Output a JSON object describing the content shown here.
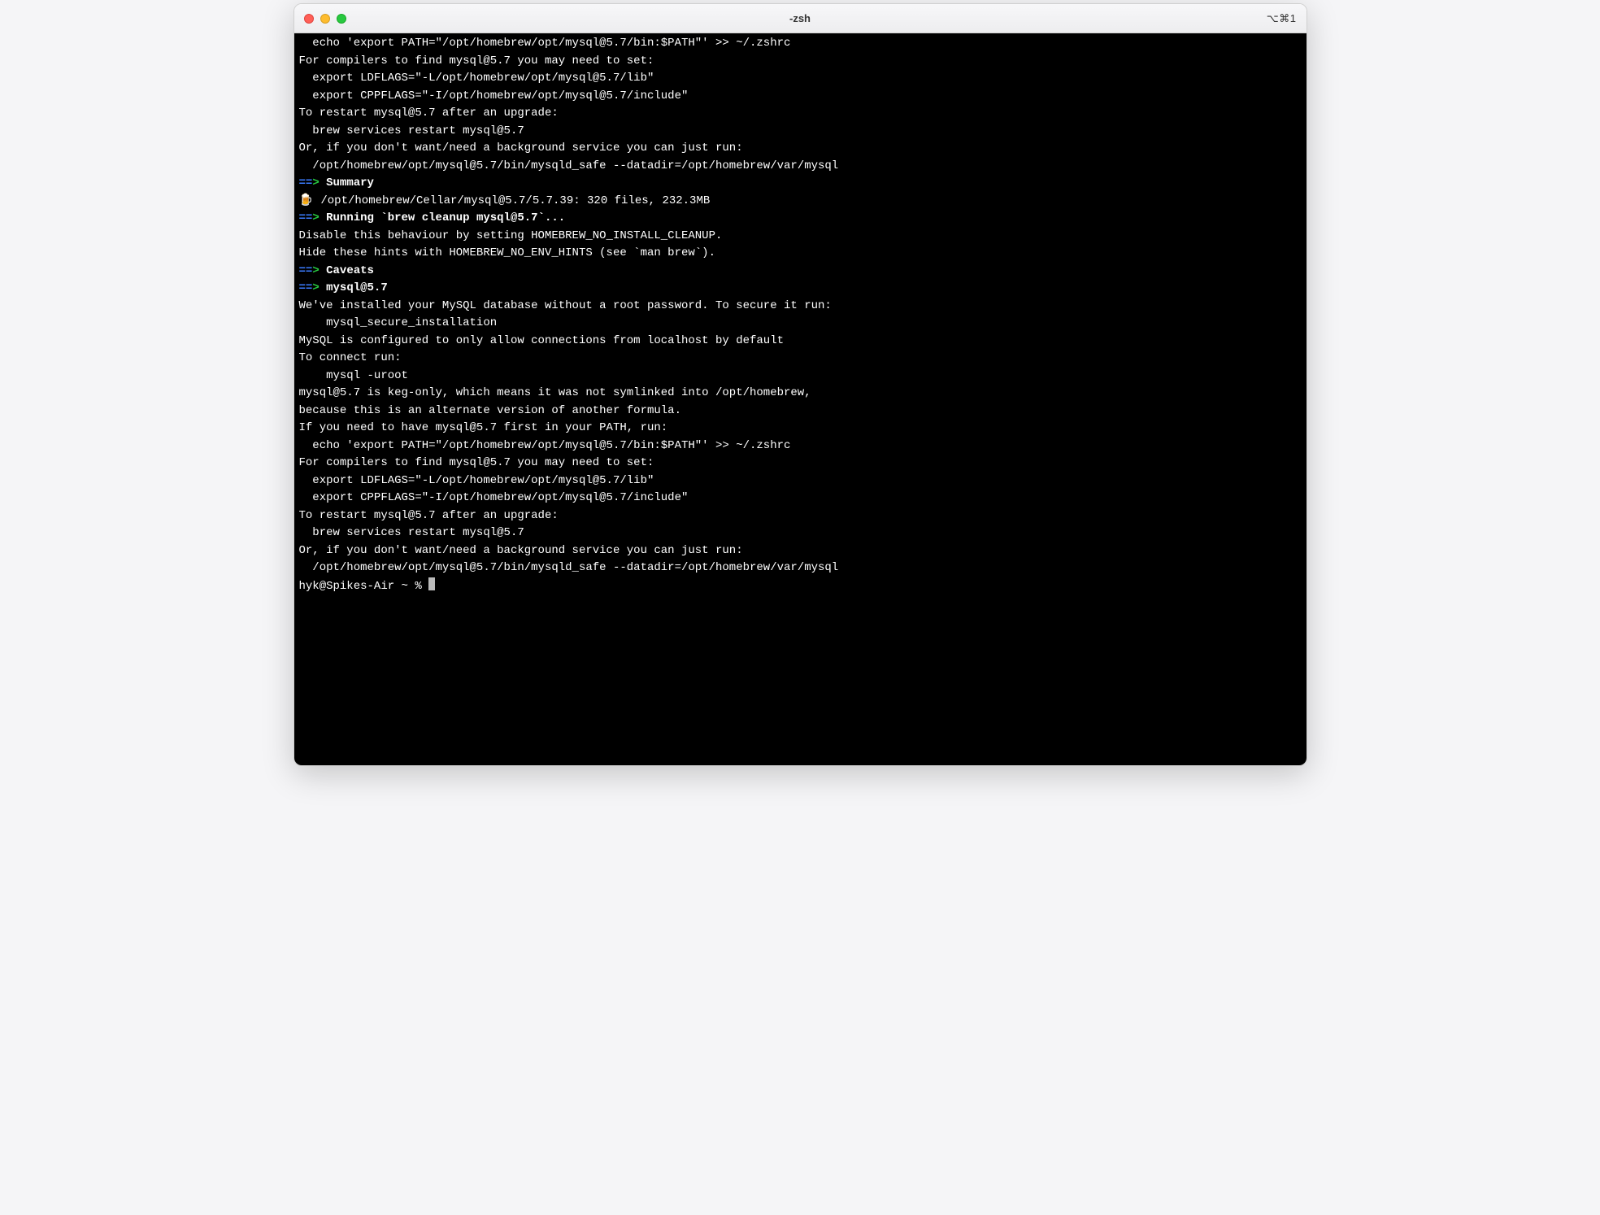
{
  "window": {
    "title": "-zsh",
    "right_shortcut": "⌥⌘1"
  },
  "terminal": {
    "lines": {
      "l01": "  echo 'export PATH=\"/opt/homebrew/opt/mysql@5.7/bin:$PATH\"' >> ~/.zshrc",
      "l02": "",
      "l03": "For compilers to find mysql@5.7 you may need to set:",
      "l04": "  export LDFLAGS=\"-L/opt/homebrew/opt/mysql@5.7/lib\"",
      "l05": "  export CPPFLAGS=\"-I/opt/homebrew/opt/mysql@5.7/include\"",
      "l06": "",
      "l07": "",
      "l08": "To restart mysql@5.7 after an upgrade:",
      "l09": "  brew services restart mysql@5.7",
      "l10": "Or, if you don't want/need a background service you can just run:",
      "l11": "  /opt/homebrew/opt/mysql@5.7/bin/mysqld_safe --datadir=/opt/homebrew/var/mysql",
      "l12_arrow": "==>",
      "l12_text": " Summary",
      "l13_icon": "🍺",
      "l13_text": "  /opt/homebrew/Cellar/mysql@5.7/5.7.39: 320 files, 232.3MB",
      "l14_arrow": "==>",
      "l14_text": " Running `brew cleanup mysql@5.7`...",
      "l15": "Disable this behaviour by setting HOMEBREW_NO_INSTALL_CLEANUP.",
      "l16": "Hide these hints with HOMEBREW_NO_ENV_HINTS (see `man brew`).",
      "l17_arrow": "==>",
      "l17_text": " Caveats",
      "l18_arrow": "==>",
      "l18_text": " mysql@5.7",
      "l19": "We've installed your MySQL database without a root password. To secure it run:",
      "l20": "    mysql_secure_installation",
      "l21": "",
      "l22": "MySQL is configured to only allow connections from localhost by default",
      "l23": "",
      "l24": "To connect run:",
      "l25": "    mysql -uroot",
      "l26": "",
      "l27": "mysql@5.7 is keg-only, which means it was not symlinked into /opt/homebrew,",
      "l28": "because this is an alternate version of another formula.",
      "l29": "",
      "l30": "If you need to have mysql@5.7 first in your PATH, run:",
      "l31": "  echo 'export PATH=\"/opt/homebrew/opt/mysql@5.7/bin:$PATH\"' >> ~/.zshrc",
      "l32": "",
      "l33": "For compilers to find mysql@5.7 you may need to set:",
      "l34": "  export LDFLAGS=\"-L/opt/homebrew/opt/mysql@5.7/lib\"",
      "l35": "  export CPPFLAGS=\"-I/opt/homebrew/opt/mysql@5.7/include\"",
      "l36": "",
      "l37": "",
      "l38": "To restart mysql@5.7 after an upgrade:",
      "l39": "  brew services restart mysql@5.7",
      "l40": "Or, if you don't want/need a background service you can just run:",
      "l41": "  /opt/homebrew/opt/mysql@5.7/bin/mysqld_safe --datadir=/opt/homebrew/var/mysql",
      "prompt": "hyk@Spikes-Air ~ % "
    }
  }
}
